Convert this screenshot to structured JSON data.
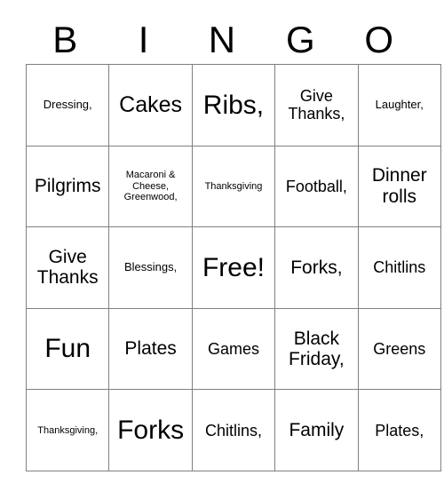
{
  "card": {
    "title_letters": [
      "B",
      "I",
      "N",
      "G",
      "O"
    ],
    "rows": [
      [
        {
          "text": "Dressing,",
          "size": "fs-s"
        },
        {
          "text": "Cakes",
          "size": "fs-xl"
        },
        {
          "text": "Ribs,",
          "size": "fs-xxl"
        },
        {
          "text": "Give Thanks,",
          "size": "fs-m"
        },
        {
          "text": "Laughter,",
          "size": "fs-s"
        }
      ],
      [
        {
          "text": "Pilgrims",
          "size": "fs-l"
        },
        {
          "text": "Macaroni & Cheese, Greenwood,",
          "size": "fs-xs"
        },
        {
          "text": "Thanksgiving",
          "size": "fs-xs"
        },
        {
          "text": "Football,",
          "size": "fs-m"
        },
        {
          "text": "Dinner rolls",
          "size": "fs-l"
        }
      ],
      [
        {
          "text": "Give Thanks",
          "size": "fs-l"
        },
        {
          "text": "Blessings,",
          "size": "fs-s"
        },
        {
          "text": "Free!",
          "size": "fs-xxl"
        },
        {
          "text": "Forks,",
          "size": "fs-l"
        },
        {
          "text": "Chitlins",
          "size": "fs-m"
        }
      ],
      [
        {
          "text": "Fun",
          "size": "fs-xxl"
        },
        {
          "text": "Plates",
          "size": "fs-l"
        },
        {
          "text": "Games",
          "size": "fs-m"
        },
        {
          "text": "Black Friday,",
          "size": "fs-l"
        },
        {
          "text": "Greens",
          "size": "fs-m"
        }
      ],
      [
        {
          "text": "Thanksgiving,",
          "size": "fs-xs"
        },
        {
          "text": "Forks",
          "size": "fs-xxl"
        },
        {
          "text": "Chitlins,",
          "size": "fs-m"
        },
        {
          "text": "Family",
          "size": "fs-l"
        },
        {
          "text": "Plates,",
          "size": "fs-m"
        }
      ]
    ]
  },
  "colors": {
    "border": "#808080",
    "text": "#000000",
    "background": "#ffffff"
  }
}
